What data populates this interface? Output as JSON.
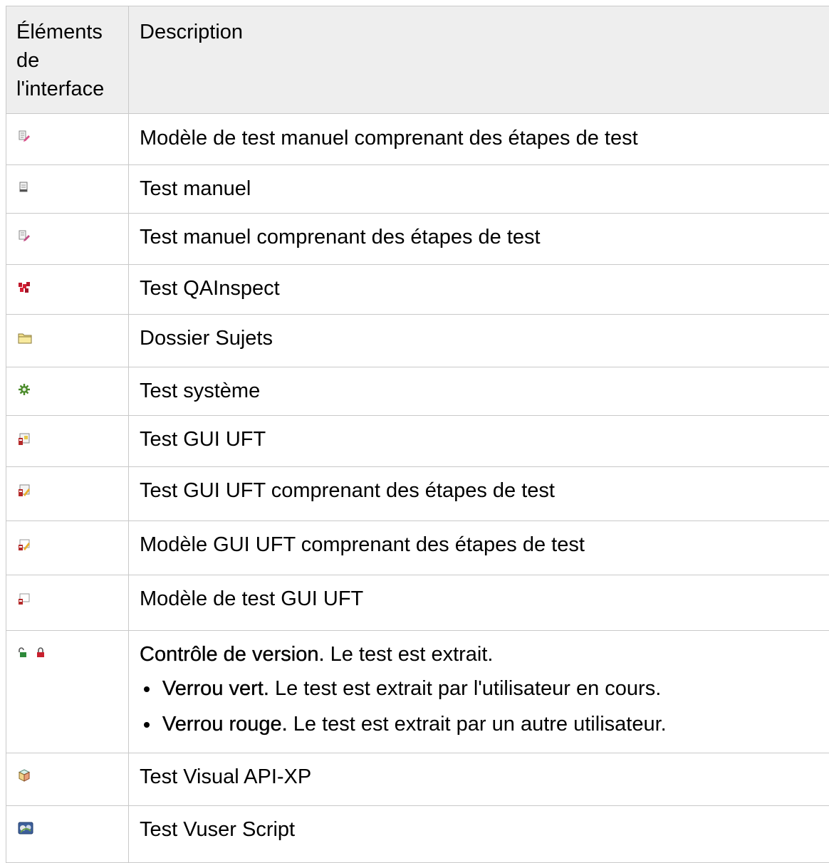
{
  "header": {
    "col_elements": "Éléments de l'interface",
    "col_description": "Description"
  },
  "rows": [
    {
      "icon": "manual-test-template-with-steps-icon",
      "text": "Modèle de test manuel comprenant des étapes de test"
    },
    {
      "icon": "manual-test-icon",
      "text": "Test manuel"
    },
    {
      "icon": "manual-test-with-steps-icon",
      "text": "Test manuel comprenant des étapes de test"
    },
    {
      "icon": "qainspect-test-icon",
      "text": "Test QAInspect"
    },
    {
      "icon": "subject-folder-icon",
      "text": "Dossier Sujets"
    },
    {
      "icon": "system-test-icon",
      "text": "Test système"
    },
    {
      "icon": "uft-gui-test-icon",
      "text": "Test GUI UFT"
    },
    {
      "icon": "uft-gui-test-with-steps-icon",
      "text": "Test GUI UFT comprenant des étapes de test"
    },
    {
      "icon": "uft-gui-template-with-steps-icon",
      "text": "Modèle GUI UFT comprenant des étapes de test"
    },
    {
      "icon": "uft-gui-test-template-icon",
      "text": "Modèle de test GUI UFT"
    },
    {
      "icon": "version-control-locks-icon",
      "title": "Contrôle de version.",
      "text": " Le test est extrait.",
      "bullets": [
        {
          "term": "Verrou vert.",
          "text": " Le test est extrait par l'utilisateur en cours."
        },
        {
          "term": "Verrou rouge.",
          "text": " Le test est extrait par un autre utilisateur."
        }
      ]
    },
    {
      "icon": "visual-api-xp-test-icon",
      "text": "Test Visual API-XP"
    },
    {
      "icon": "vuser-script-test-icon",
      "text": "Test Vuser Script"
    }
  ]
}
